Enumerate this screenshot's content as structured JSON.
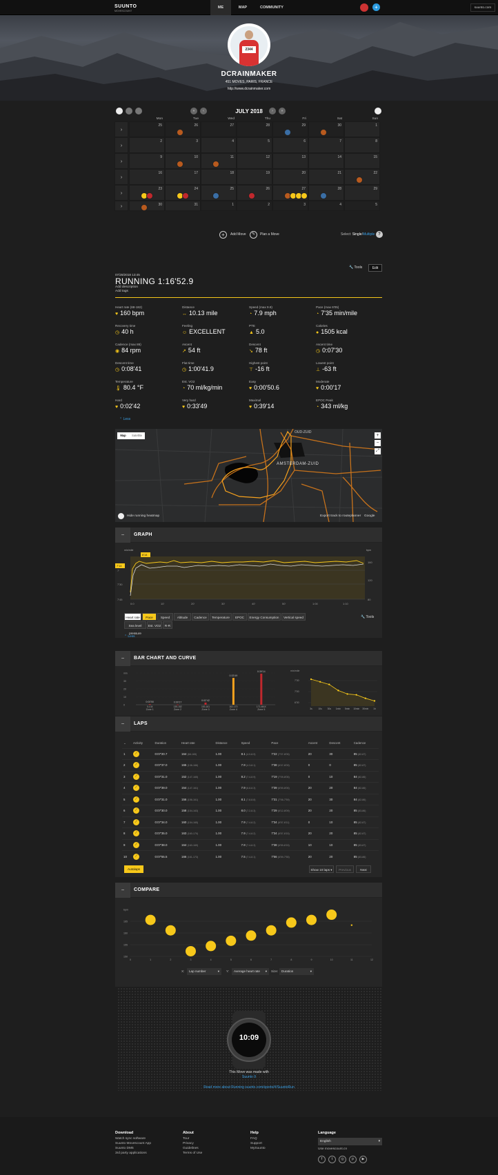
{
  "header": {
    "logo": "SUUNTO",
    "logo_sub": "MOVESCOUNT",
    "nav": [
      "ME",
      "MAP",
      "COMMUNITY"
    ],
    "site": "suunto.com",
    "accent": "#f7c81a",
    "avatar_bib": "2344"
  },
  "profile": {
    "name": "DCRAINMAKER",
    "meta": "451 MOVES, PARIS, FRANCE",
    "url": "http://www.dcrainmaker.com"
  },
  "calendar": {
    "month": "JULY 2018",
    "days": [
      "Mon",
      "Tue",
      "Wed",
      "Thu",
      "Fri",
      "Sat",
      "Sun"
    ],
    "weeks": [
      [
        "25",
        "26",
        "27",
        "28",
        "29",
        "30",
        "1"
      ],
      [
        "2",
        "3",
        "4",
        "5",
        "6",
        "7",
        "8"
      ],
      [
        "9",
        "10",
        "11",
        "12",
        "13",
        "14",
        "15"
      ],
      [
        "16",
        "17",
        "18",
        "19",
        "20",
        "21",
        "22"
      ],
      [
        "23",
        "24",
        "25",
        "26",
        "27",
        "28",
        "29"
      ],
      [
        "30",
        "31",
        "1",
        "2",
        "3",
        "4",
        "5"
      ]
    ],
    "add_move": "Add Move",
    "plan_move": "Plan a Move",
    "select_prefix": "Select:",
    "select_single": "Single",
    "select_sep": "/",
    "select_multiple": "Multiple",
    "help": "?"
  },
  "move": {
    "date": "07/28/2018 13:45",
    "title": "RUNNING 1:16'52.9",
    "add_description": "Add description",
    "add_tags": "Add tags",
    "tools": "Tools",
    "edit": "Edit",
    "stats": [
      {
        "label": "Heart rate (68-182)",
        "value": "160 bpm",
        "icon": "♥"
      },
      {
        "label": "Distance",
        "value": "10.13 mile",
        "icon": "↔"
      },
      {
        "label": "Speed (max 9.8)",
        "value": "7.9 mph",
        "icon": "◔"
      },
      {
        "label": "Pace (max 6'05)",
        "value": "7'35 min/mile",
        "icon": "◔"
      },
      {
        "label": "Recovery time",
        "value": "40 h",
        "icon": "◷"
      },
      {
        "label": "Feeling",
        "value": "EXCELLENT",
        "icon": "☺"
      },
      {
        "label": "PTE",
        "value": "5.0",
        "icon": "▲"
      },
      {
        "label": "Calories",
        "value": "1505 kcal",
        "icon": "●"
      },
      {
        "label": "Cadence (max 86)",
        "value": "84 rpm",
        "icon": "◉"
      },
      {
        "label": "Ascent",
        "value": "54 ft",
        "icon": "↗"
      },
      {
        "label": "Descent",
        "value": "78 ft",
        "icon": "↘"
      },
      {
        "label": "Ascent time",
        "value": "0:07'30",
        "icon": "◷"
      },
      {
        "label": "Descent time",
        "value": "0:08'41",
        "icon": "◷"
      },
      {
        "label": "Flat time",
        "value": "1:00'41.9",
        "icon": "◷"
      },
      {
        "label": "Highest point",
        "value": "-16 ft",
        "icon": "⊤"
      },
      {
        "label": "Lowest point",
        "value": "-63 ft",
        "icon": "⊥"
      },
      {
        "label": "Temperature",
        "value": "80.4 °F",
        "icon": "🌡"
      },
      {
        "label": "Est. VO2",
        "value": "70 ml/kg/min",
        "icon": "◔"
      },
      {
        "label": "Easy",
        "value": "0:00'50.6",
        "icon": "♥"
      },
      {
        "label": "Moderate",
        "value": "0:00'17",
        "icon": "♥"
      },
      {
        "label": "Hard",
        "value": "0:02'42",
        "icon": "♥"
      },
      {
        "label": "Very hard",
        "value": "0:33'49",
        "icon": "♥"
      },
      {
        "label": "Maximal",
        "value": "0:39'14",
        "icon": "♥"
      },
      {
        "label": "EPOC Peak",
        "value": "343 ml/kg",
        "icon": "◔"
      }
    ],
    "less": "Less"
  },
  "map": {
    "tab_map": "Map",
    "tab_satellite": "Satellite",
    "label1": "AMSTERDAM-ZUID",
    "label2": "OUD-ZUID",
    "heatmap": "Hide running heatmap",
    "export": "Export track to routeplanner",
    "google": "Google"
  },
  "graph": {
    "title": "GRAPH",
    "left_unit": "min/mile",
    "right_unit": "bpm",
    "yleft": [
      "7'",
      "7'30",
      "7'45"
    ],
    "yright": [
      "160",
      "120",
      "80"
    ],
    "xlabels": [
      "0:0",
      "10'",
      "20'",
      "30'",
      "40'",
      "50'",
      "1:00",
      "1:10"
    ],
    "readout_left": "7'14",
    "readout_top": "6'14",
    "tabs": [
      "Heart rate",
      "Pace",
      "Speed",
      "Altitude",
      "Cadence",
      "Temperature",
      "EPOC",
      "Energy Consumption",
      "Vertical speed"
    ],
    "tabs2": [
      "Sea level pressure",
      "Est. VO2",
      "R-R"
    ],
    "tools": "Tools",
    "less": "Less"
  },
  "chart_data": [
    {
      "type": "bar",
      "title": "BAR CHART AND CURVE",
      "ylabel": "min",
      "categories": [
        "Zone 1",
        "Zone 2",
        "Zone 3",
        "Zone 4",
        "Zone 5"
      ],
      "values": [
        0.84,
        0.28,
        2.7,
        33.8,
        39.2
      ],
      "data_labels": [
        "0:00'50",
        "0:00'17",
        "0:02'42",
        "0:33'49",
        "0:39'14"
      ],
      "sublabels": [
        "0-134",
        "135-152",
        "153-161",
        "162-170",
        "171-MAX"
      ],
      "ylim": [
        0,
        40
      ],
      "yticks": [
        "min",
        "30",
        "20",
        "10",
        "0"
      ]
    },
    {
      "type": "line",
      "ylabel": "min/mile",
      "x": [
        "3s",
        "10s",
        "30s",
        "1min",
        "5min",
        "10min",
        "30min",
        "1h"
      ],
      "values": [
        6.2,
        6.35,
        6.5,
        6.85,
        7.05,
        7.1,
        7.3,
        7.45
      ],
      "yticks": [
        "7'30",
        "7'00",
        "6'30"
      ]
    },
    {
      "type": "scatter",
      "title": "COMPARE",
      "xlabel": "Lap number",
      "ylabel": "Average heart rate",
      "y_unit": "bpm",
      "size": "Duration",
      "x": [
        1,
        2,
        3,
        4,
        5,
        6,
        7,
        8,
        9,
        10
      ],
      "values": [
        164,
        160,
        152,
        154,
        156,
        158,
        160,
        163,
        164,
        166
      ],
      "xticks": [
        "0",
        "1",
        "2",
        "3",
        "4",
        "5",
        "6",
        "7",
        "8",
        "9",
        "10",
        "11",
        "12"
      ],
      "yticks": [
        "bpm",
        "165",
        "160",
        "155",
        "150"
      ],
      "ylim": [
        150,
        168
      ]
    }
  ],
  "laps": {
    "title": "LAPS",
    "columns": [
      "Activity",
      "Duration",
      "Heart rate",
      "Distance",
      "Speed",
      "Pace",
      "Ascent",
      "Descent",
      "Cadence"
    ],
    "rows": [
      [
        "1",
        "0:07'20.7",
        "164",
        "(68-165)",
        "1.00",
        "8.1",
        "(4.0-8.9)",
        "7'22",
        "(7'07-8'05)",
        "20",
        "30",
        "85",
        "(82-87)"
      ],
      [
        "2",
        "0:07'37.0",
        "165",
        "(136-166)",
        "1.00",
        "7.9",
        "(4.3-8.1)",
        "7'38",
        "(6'47-8'09)",
        "0",
        "0",
        "85",
        "(82-87)"
      ],
      [
        "3",
        "0:07'31.0",
        "152",
        "(147-165)",
        "1.00",
        "8.2",
        "(7.4-8.9)",
        "7'19",
        "(7'09-8'05)",
        "0",
        "10",
        "84",
        "(82-86)"
      ],
      [
        "4",
        "0:07'39.0",
        "154",
        "(147-161)",
        "1.00",
        "7.9",
        "(6.8-8.3)",
        "7'39",
        "(6'59-8'05)",
        "20",
        "20",
        "84",
        "(82-86)"
      ],
      [
        "5",
        "0:07'31.0",
        "156",
        "(156-161)",
        "1.00",
        "8.1",
        "(7.8-8.8)",
        "7'31",
        "(7'06-7'59)",
        "20",
        "30",
        "84",
        "(82-86)"
      ],
      [
        "6",
        "0:07'30.0",
        "158",
        "(154-163)",
        "1.00",
        "8.0",
        "(7.2-8.3)",
        "7'29",
        "(6'12-8'09)",
        "20",
        "20",
        "85",
        "(83-86)"
      ],
      [
        "7",
        "0:07'34.0",
        "160",
        "(154-165)",
        "1.00",
        "7.9",
        "(7.4-8.2)",
        "7'34",
        "(6'57-8'11)",
        "0",
        "10",
        "85",
        "(82-87)"
      ],
      [
        "8",
        "0:07'35.0",
        "163",
        "(160-170)",
        "1.00",
        "7.9",
        "(7.4-8.2)",
        "7'34",
        "(6'57-8'15)",
        "20",
        "20",
        "85",
        "(82-87)"
      ],
      [
        "9",
        "0:07'38.0",
        "164",
        "(160-169)",
        "1.00",
        "7.9",
        "(7.4-8.3)",
        "7'38",
        "(6'59-8'15)",
        "10",
        "10",
        "85",
        "(83-87)"
      ],
      [
        "10",
        "0:07'55.5",
        "166",
        "(161-173)",
        "1.00",
        "7.5",
        "(7.4-8.1)",
        "7'56",
        "(6'59-7'55)",
        "20",
        "20",
        "85",
        "(83-86)"
      ]
    ],
    "autolaps": "Autolaps",
    "show": "Show 10 laps",
    "previous": "Previous",
    "next": "Next"
  },
  "compare": {
    "x_label": "X:",
    "x_value": "Lap number",
    "y_label": "Y:",
    "y_value": "Average heart rate",
    "size_label": "Size:",
    "size_value": "Duration"
  },
  "watch": {
    "time": "10:09",
    "line1": "This Move was made with",
    "line2": "Suunto 9",
    "read_more": "Read more about Running suunto.com/sports/#/SuuntoRun"
  },
  "footer": {
    "cols": [
      {
        "h": "Download",
        "links": [
          "Watch sync software",
          "Suunto Movescount App",
          "Suunto DM5",
          "3rd party applications"
        ]
      },
      {
        "h": "About",
        "links": [
          "Tour",
          "Privacy",
          "Guidelines",
          "Terms of Use"
        ]
      },
      {
        "h": "Help",
        "links": [
          "FAQ",
          "Support",
          "MySuunto"
        ]
      }
    ],
    "lang_h": "Language",
    "lang": "English",
    "alt": "Use movescount.cn"
  }
}
